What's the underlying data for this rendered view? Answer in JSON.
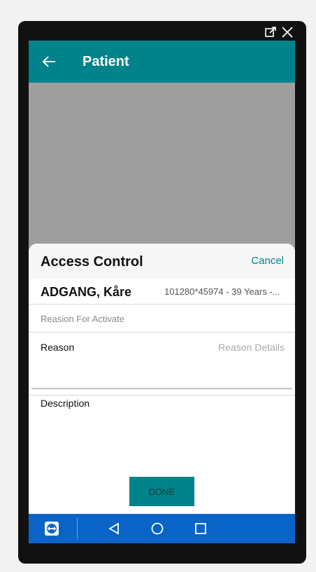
{
  "app_bar": {
    "title": "Patient",
    "back_icon": "arrow-left-icon",
    "color": "#00838a"
  },
  "window_controls": {
    "icons": [
      "open-external-icon",
      "close-icon"
    ]
  },
  "access_control": {
    "title": "Access Control",
    "cancel_label": "Cancel",
    "patient_name": "ADGANG, Kåre",
    "patient_info": "101280*45974 - 39 Years -...",
    "section_label": "Reasion For Activate",
    "reason_label": "Reason",
    "reason_placeholder": "Reason Details",
    "description_label": "Description",
    "done_label": "DONE"
  },
  "nav_bar": {
    "color": "#0a64c8",
    "items": [
      "teamviewer-icon",
      "back-triangle-icon",
      "home-circle-icon",
      "recent-square-icon"
    ]
  }
}
